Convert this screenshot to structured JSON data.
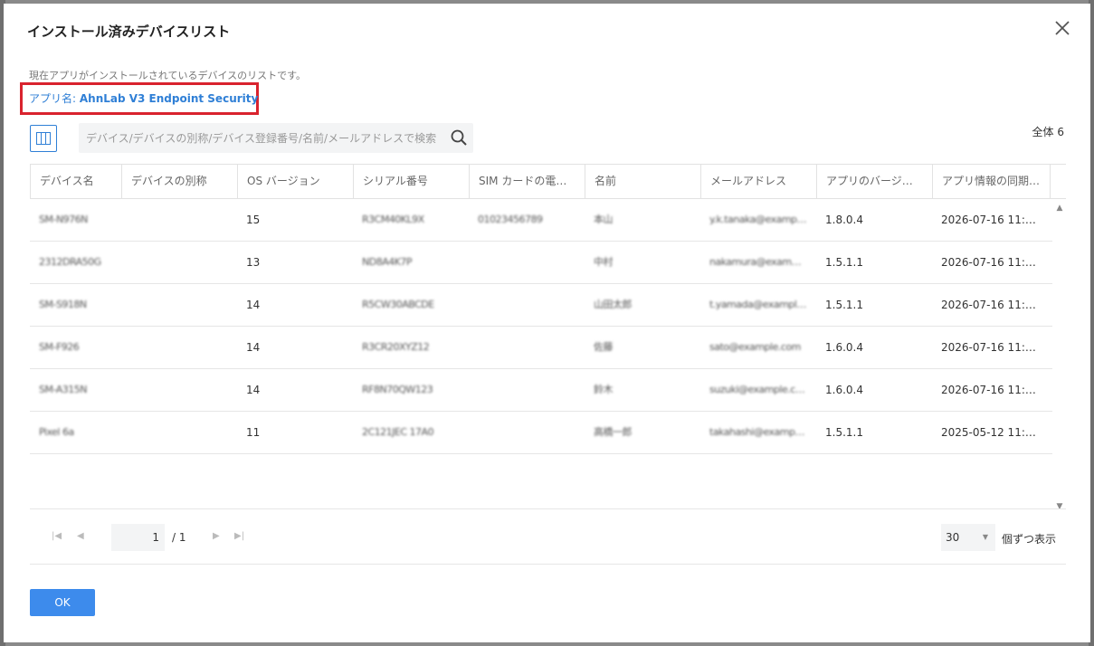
{
  "dialog": {
    "title": "インストール済みデバイスリスト",
    "description": "現在アプリがインストールされているデバイスのリストです。",
    "app_label_prefix": "アプリ名: ",
    "app_name": "AhnLab V3 Endpoint Security",
    "close_icon": "close-icon"
  },
  "toolbar": {
    "column_settings_icon": "columns-icon",
    "search_placeholder": "デバイス/デバイスの別称/デバイス登録番号/名前/メールアドレスで検索",
    "search_icon": "search-icon",
    "total_label": "全体 6"
  },
  "table": {
    "headers": [
      "デバイス名",
      "デバイスの別称",
      "OS バージョン",
      "シリアル番号",
      "SIM カードの電話…",
      "名前",
      "メールアドレス",
      "アプリのバージョン",
      "アプリ情報の同期日時"
    ],
    "rows": [
      {
        "device": "SM-N976N",
        "alias": "",
        "os": "15",
        "serial": "R3CM40KL9X",
        "sim": "01023456789",
        "name": "本山",
        "email": "y.k.tanaka@example.com",
        "app_version": "1.8.0.4",
        "synced": "2026-07-16 11:…"
      },
      {
        "device": "2312DRA50G",
        "alias": "",
        "os": "13",
        "serial": "ND8A4K7P",
        "sim": "",
        "name": "中村",
        "email": "nakamura@example.com",
        "app_version": "1.5.1.1",
        "synced": "2026-07-16 11:…"
      },
      {
        "device": "SM-S918N",
        "alias": "",
        "os": "14",
        "serial": "R5CW30ABCDE",
        "sim": "",
        "name": "山田太郎",
        "email": "t.yamada@example.com",
        "app_version": "1.5.1.1",
        "synced": "2026-07-16 11:…"
      },
      {
        "device": "SM-F926",
        "alias": "",
        "os": "14",
        "serial": "R3CR20XYZ12",
        "sim": "",
        "name": "佐藤",
        "email": "sato@example.com",
        "app_version": "1.6.0.4",
        "synced": "2026-07-16 11:…"
      },
      {
        "device": "SM-A315N",
        "alias": "",
        "os": "14",
        "serial": "RF8N70QW123",
        "sim": "",
        "name": "鈴木",
        "email": "suzuki@example.com",
        "app_version": "1.6.0.4",
        "synced": "2026-07-16 11:…"
      },
      {
        "device": "Pixel 6a",
        "alias": "",
        "os": "11",
        "serial": "2C121JEC 17A0",
        "sim": "",
        "name": "高橋一郎",
        "email": "takahashi@example.com",
        "app_version": "1.5.1.1",
        "synced": "2025-05-12 11:…"
      }
    ]
  },
  "pager": {
    "current_page": "1",
    "total_pages": "/ 1",
    "per_page": "30",
    "per_page_label": "個ずつ表示"
  },
  "footer": {
    "ok_label": "OK"
  },
  "colors": {
    "accent": "#3d8bec",
    "highlight_border": "#d9232e"
  }
}
